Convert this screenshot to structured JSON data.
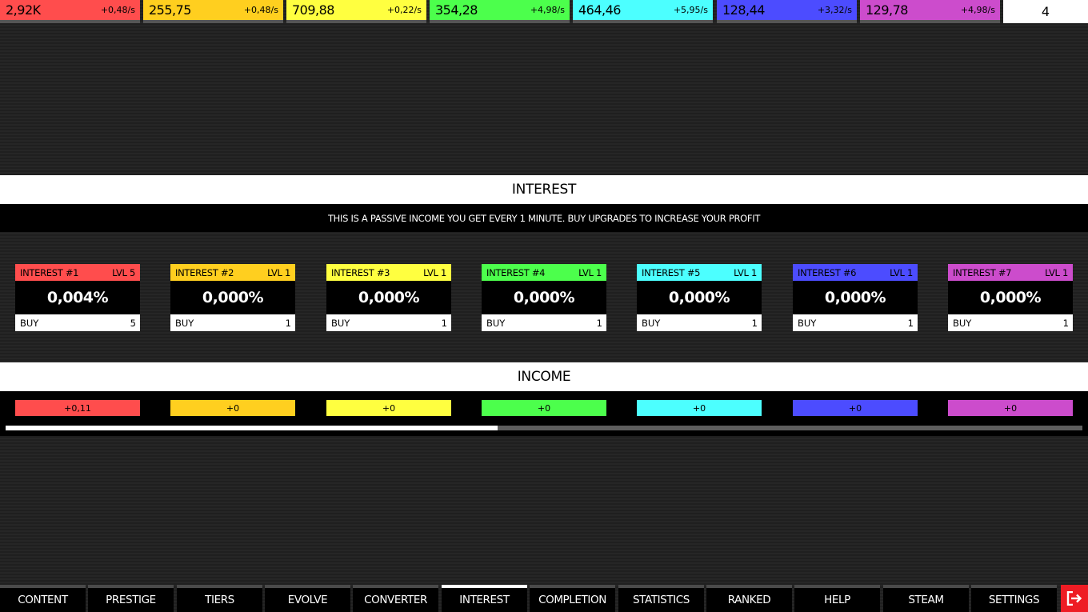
{
  "resources": [
    {
      "amount": "2,92K",
      "rate": "+0,48/s",
      "color": "#ff4d4d"
    },
    {
      "amount": "255,75",
      "rate": "+0,48/s",
      "color": "#ffcf1f"
    },
    {
      "amount": "709,88",
      "rate": "+0,22/s",
      "color": "#ffff40"
    },
    {
      "amount": "354,28",
      "rate": "+4,98/s",
      "color": "#4cff4c"
    },
    {
      "amount": "464,46",
      "rate": "+5,95/s",
      "color": "#4cffff"
    },
    {
      "amount": "128,44",
      "rate": "+3,32/s",
      "color": "#4c4cff"
    },
    {
      "amount": "129,78",
      "rate": "+4,98/s",
      "color": "#cc4ccc"
    }
  ],
  "counter": "4",
  "interest_section": {
    "title": "INTEREST",
    "description": "THIS IS A PASSIVE INCOME YOU GET EVERY 1 MINUTE. BUY UPGRADES TO INCREASE YOUR PROFIT",
    "cards": [
      {
        "name": "INTEREST #1",
        "level": "LVL 5",
        "percent": "0,004%",
        "buy_label": "BUY",
        "buy_count": "5"
      },
      {
        "name": "INTEREST #2",
        "level": "LVL 1",
        "percent": "0,000%",
        "buy_label": "BUY",
        "buy_count": "1"
      },
      {
        "name": "INTEREST #3",
        "level": "LVL 1",
        "percent": "0,000%",
        "buy_label": "BUY",
        "buy_count": "1"
      },
      {
        "name": "INTEREST #4",
        "level": "LVL 1",
        "percent": "0,000%",
        "buy_label": "BUY",
        "buy_count": "1"
      },
      {
        "name": "INTEREST #5",
        "level": "LVL 1",
        "percent": "0,000%",
        "buy_label": "BUY",
        "buy_count": "1"
      },
      {
        "name": "INTEREST #6",
        "level": "LVL 1",
        "percent": "0,000%",
        "buy_label": "BUY",
        "buy_count": "1"
      },
      {
        "name": "INTEREST #7",
        "level": "LVL 1",
        "percent": "0,000%",
        "buy_label": "BUY",
        "buy_count": "1"
      }
    ]
  },
  "income_section": {
    "title": "INCOME",
    "values": [
      "+0,11",
      "+0",
      "+0",
      "+0",
      "+0",
      "+0",
      "+0"
    ],
    "progress_fraction": 0.457
  },
  "nav": {
    "tabs": [
      "CONTENT",
      "PRESTIGE",
      "TIERS",
      "EVOLVE",
      "CONVERTER",
      "INTEREST",
      "COMPLETION",
      "STATISTICS",
      "RANKED",
      "HELP",
      "STEAM",
      "SETTINGS"
    ],
    "active_tab": "INTEREST",
    "exit_icon": "exit-icon"
  }
}
